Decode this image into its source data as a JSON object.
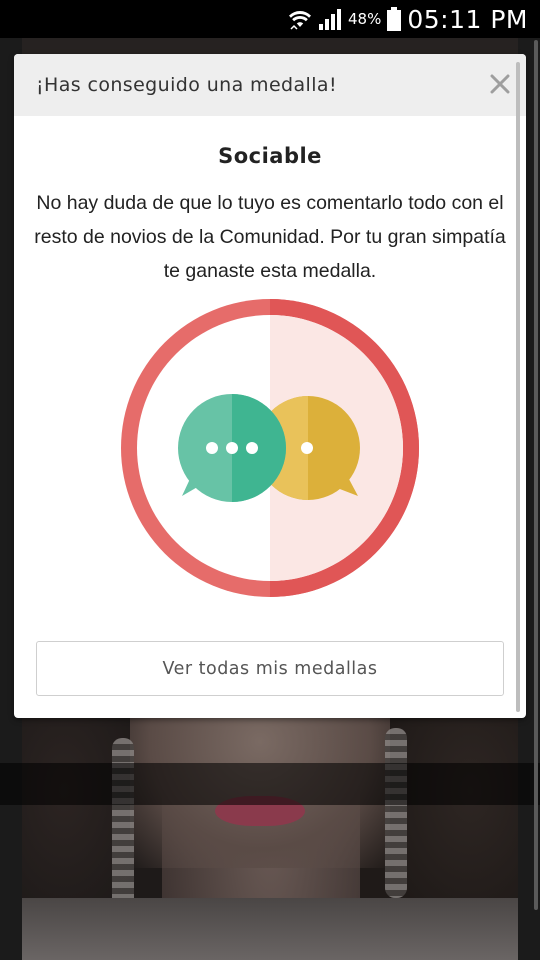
{
  "status_bar": {
    "battery_percent": "48%",
    "time": "05:11 PM"
  },
  "dialog": {
    "title": "¡Has conseguido una medalla!",
    "medal_name": "Sociable",
    "description": "No hay duda de que lo tuyo es comentarlo todo con el resto de novios de la Comunidad. Por tu gran simpatía te ganaste esta medalla.",
    "view_all_label": "Ver todas mis medallas"
  },
  "icons": {
    "close": "close-icon",
    "badge": "chat-bubbles-medal-icon",
    "wifi": "wifi-icon",
    "signal": "signal-icon",
    "battery": "battery-icon"
  },
  "colors": {
    "ring_red": "#e45c5c",
    "ring_inner_tint": "#fbe7e4",
    "bubble_green": "#3fb591",
    "bubble_yellow": "#e3b43a"
  }
}
